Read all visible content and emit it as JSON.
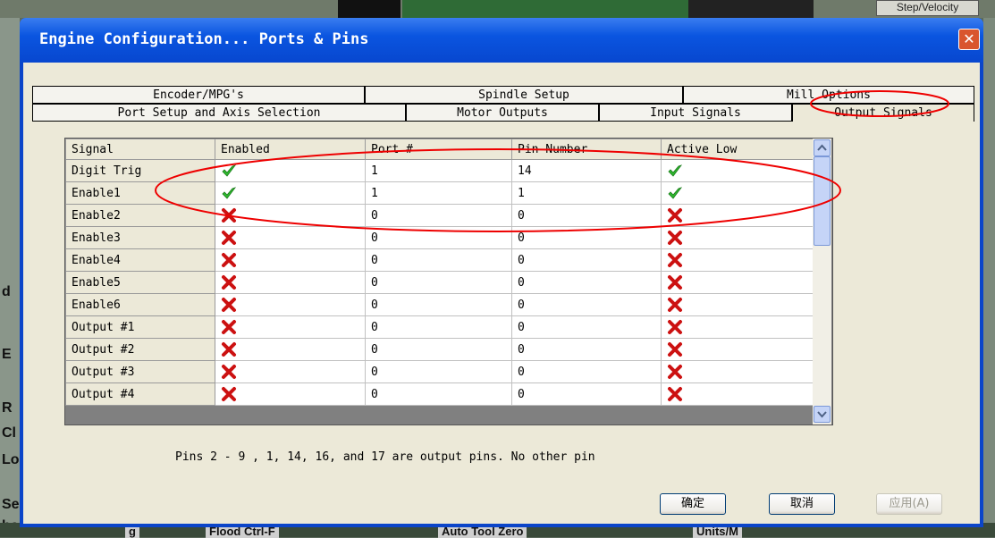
{
  "background": {
    "top_button": "Step/Velocity",
    "left_chars": [
      "d",
      "E",
      "R",
      "Cl",
      "Lo",
      "Se",
      "he"
    ],
    "bottom_labels": [
      "g",
      "Flood Ctrl-F",
      "Auto Tool Zero",
      "Units/M"
    ]
  },
  "window": {
    "title": "Engine Configuration... Ports & Pins",
    "close_glyph": "✕"
  },
  "tabs": {
    "row1": [
      "Encoder/MPG's",
      "Spindle Setup",
      "Mill Options"
    ],
    "row2": [
      "Port Setup and Axis Selection",
      "Motor Outputs",
      "Input Signals",
      "Output Signals"
    ],
    "active": "Output Signals"
  },
  "grid": {
    "columns": [
      "Signal",
      "Enabled",
      "Port #",
      "Pin Number",
      "Active Low"
    ],
    "rows": [
      {
        "signal": "Digit Trig",
        "enabled": true,
        "port": "1",
        "pin": "14",
        "active_low": true
      },
      {
        "signal": "Enable1",
        "enabled": true,
        "port": "1",
        "pin": "1",
        "active_low": true
      },
      {
        "signal": "Enable2",
        "enabled": false,
        "port": "0",
        "pin": "0",
        "active_low": false
      },
      {
        "signal": "Enable3",
        "enabled": false,
        "port": "0",
        "pin": "0",
        "active_low": false
      },
      {
        "signal": "Enable4",
        "enabled": false,
        "port": "0",
        "pin": "0",
        "active_low": false
      },
      {
        "signal": "Enable5",
        "enabled": false,
        "port": "0",
        "pin": "0",
        "active_low": false
      },
      {
        "signal": "Enable6",
        "enabled": false,
        "port": "0",
        "pin": "0",
        "active_low": false
      },
      {
        "signal": "Output #1",
        "enabled": false,
        "port": "0",
        "pin": "0",
        "active_low": false
      },
      {
        "signal": "Output #2",
        "enabled": false,
        "port": "0",
        "pin": "0",
        "active_low": false
      },
      {
        "signal": "Output #3",
        "enabled": false,
        "port": "0",
        "pin": "0",
        "active_low": false
      },
      {
        "signal": "Output #4",
        "enabled": false,
        "port": "0",
        "pin": "0",
        "active_low": false
      }
    ]
  },
  "note": "Pins 2 - 9 , 1, 14, 16, and 17 are output pins. No  other pin",
  "buttons": {
    "ok": "确定",
    "cancel": "取消",
    "apply": "应用(A)"
  },
  "colors": {
    "title_bar": "#0a55e0",
    "check": "#2eb82e",
    "cross": "#cc1111",
    "annotation": "#ee0000"
  }
}
